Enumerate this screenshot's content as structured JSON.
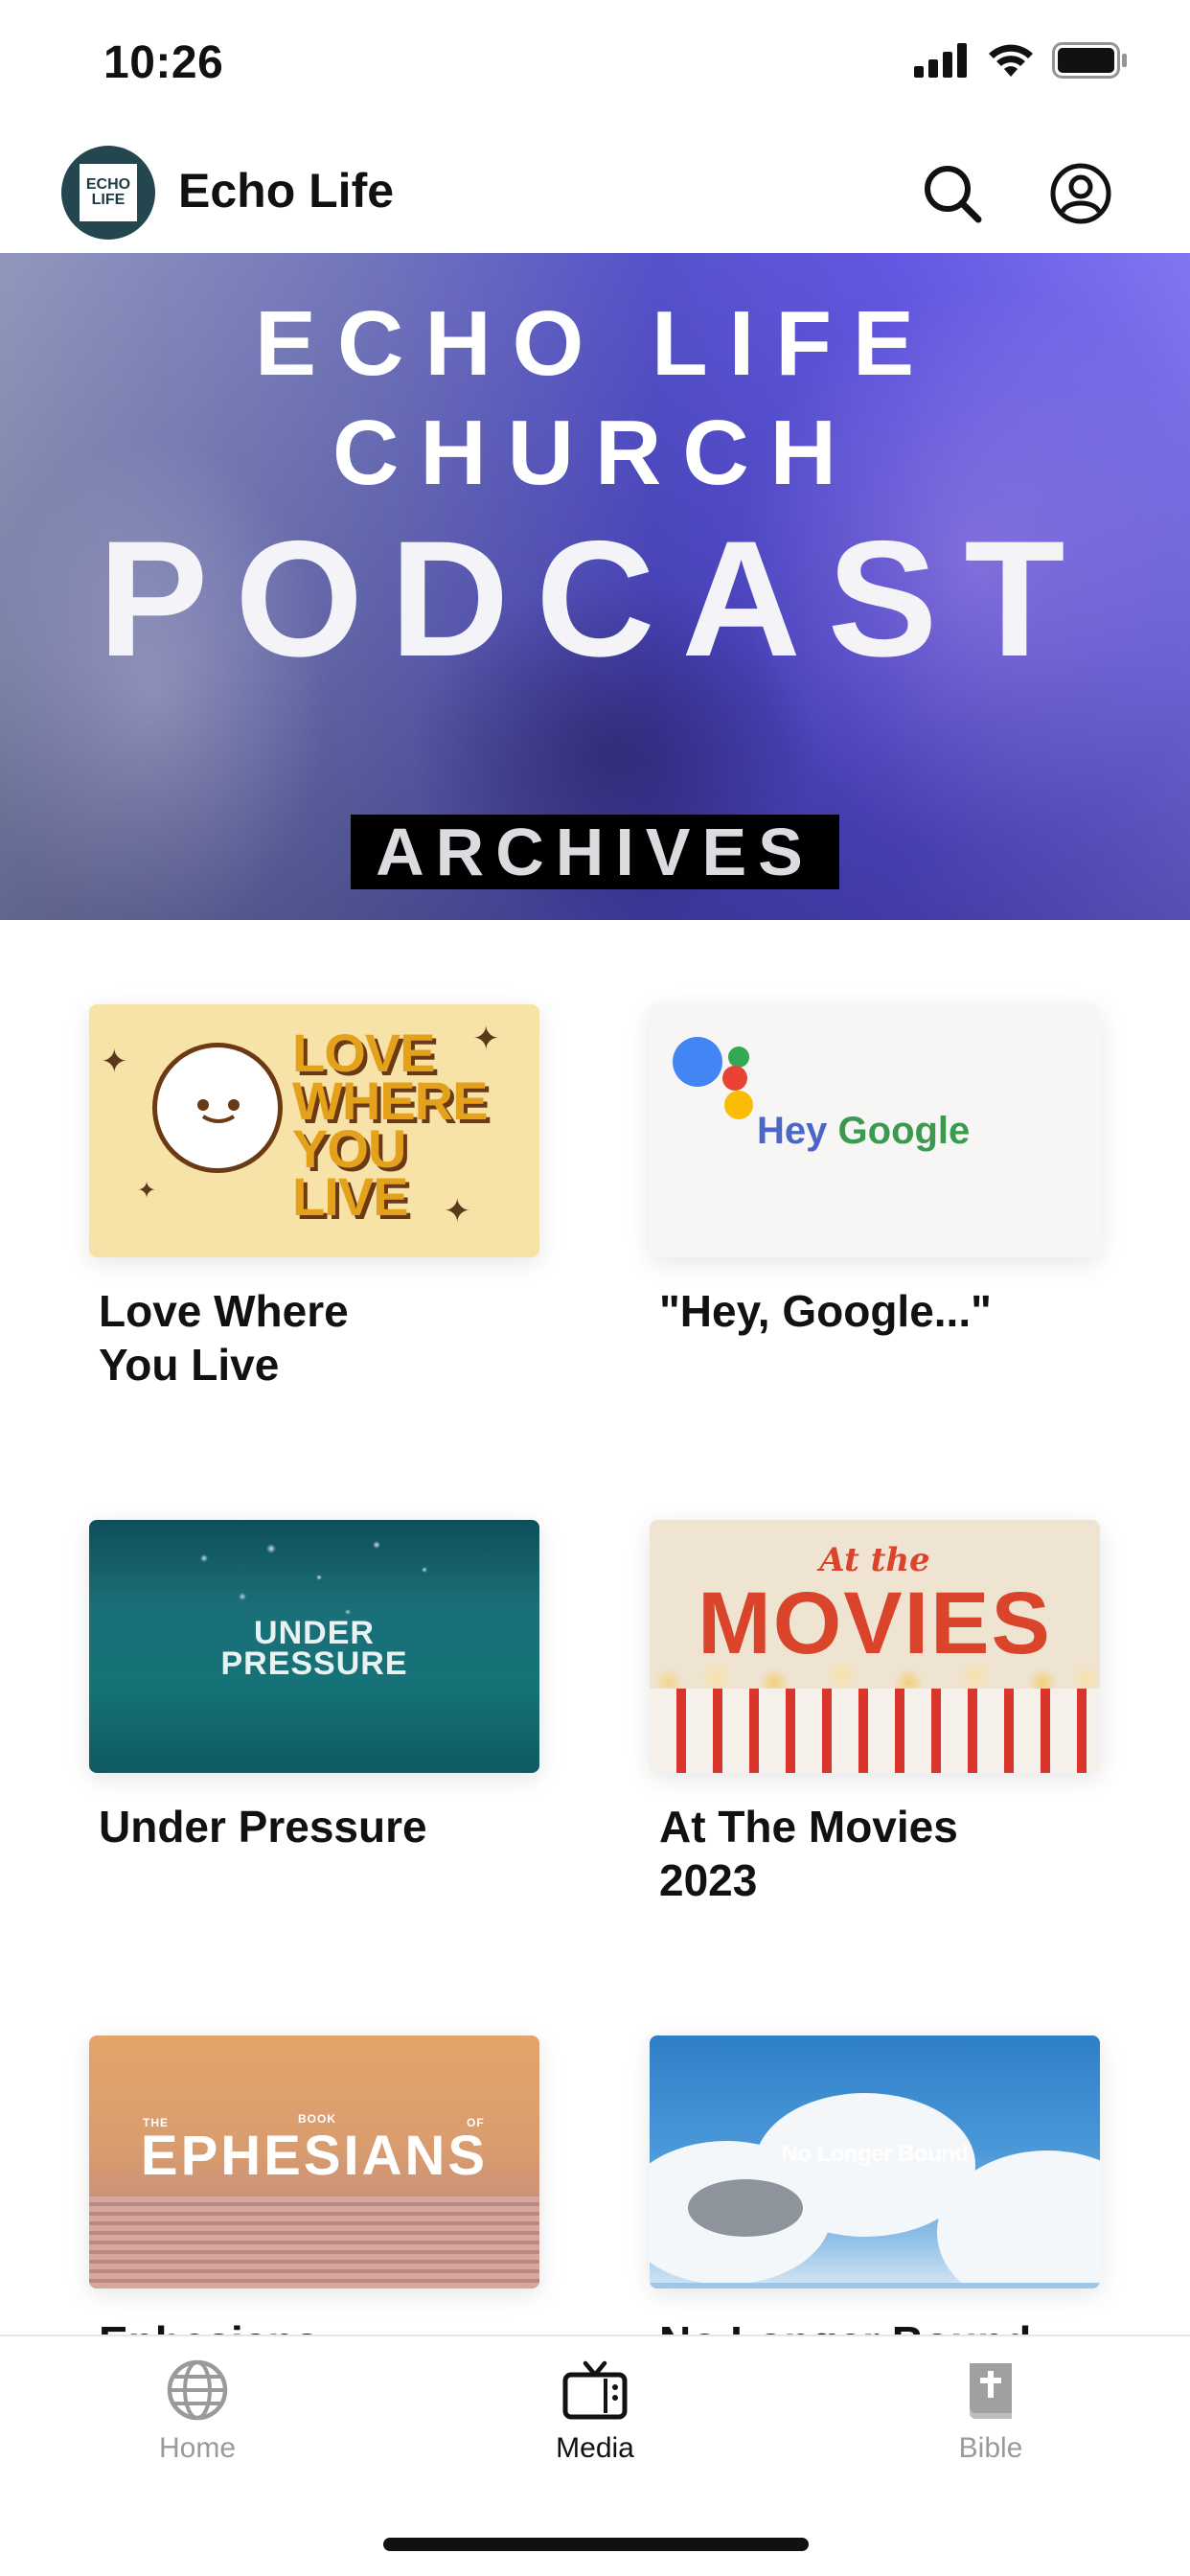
{
  "status_bar": {
    "time": "10:26",
    "icons": [
      "cellular-signal-icon",
      "wifi-icon",
      "battery-icon"
    ]
  },
  "header": {
    "logo_text_line1": "ECHO",
    "logo_text_line2": "LIFE",
    "title": "Echo Life",
    "actions": [
      "search-icon",
      "account-icon"
    ]
  },
  "hero": {
    "line1": "ECHO LIFE",
    "line2": "CHURCH",
    "line3": "PODCAST",
    "badge": "ARCHIVES"
  },
  "series": [
    {
      "title_line1": "Love Where",
      "title_line2": "You Live",
      "thumb_text": [
        "LOVE",
        "WHERE",
        "YOU",
        "LIVE"
      ]
    },
    {
      "title_line1": "\"Hey, Google...\"",
      "title_line2": "",
      "thumb_text_hey": "Hey",
      "thumb_text_google": "Google"
    },
    {
      "title_line1": "Under Pressure",
      "title_line2": "",
      "thumb_text": [
        "UNDER",
        "PRESSURE"
      ]
    },
    {
      "title_line1": "At The Movies",
      "title_line2": "2023",
      "thumb_at_the": "At the",
      "thumb_movies": "MOVIES"
    },
    {
      "title_line1": "Ephesians",
      "title_line2": "",
      "thumb_the": "THE",
      "thumb_book": "BOOK",
      "thumb_of": "OF",
      "thumb_title": "EPHESIANS"
    },
    {
      "title_line1": "No Longer Bound",
      "title_line2": "",
      "thumb_text": "No Longer Bound"
    }
  ],
  "tabbar": {
    "tabs": [
      {
        "label": "Home",
        "icon": "globe-icon",
        "active": false
      },
      {
        "label": "Media",
        "icon": "tv-icon",
        "active": true
      },
      {
        "label": "Bible",
        "icon": "bible-icon",
        "active": false
      }
    ],
    "colors": {
      "active": "#111111",
      "inactive": "#9a9a9a"
    }
  }
}
